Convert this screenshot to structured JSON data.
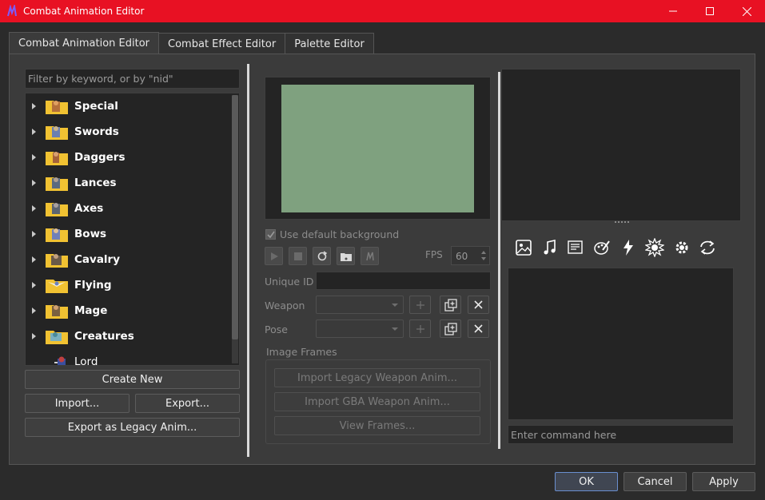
{
  "window": {
    "title": "Combat Animation Editor",
    "title_bar_color": "#e81123"
  },
  "tabs": [
    {
      "label": "Combat Animation Editor",
      "active": true
    },
    {
      "label": "Combat Effect Editor",
      "active": false
    },
    {
      "label": "Palette Editor",
      "active": false
    }
  ],
  "left": {
    "filter_placeholder": "Filter by keyword, or by \"nid\"",
    "tree": [
      {
        "label": "Special",
        "kind": "folder"
      },
      {
        "label": "Swords",
        "kind": "folder"
      },
      {
        "label": "Daggers",
        "kind": "folder"
      },
      {
        "label": "Lances",
        "kind": "folder"
      },
      {
        "label": "Axes",
        "kind": "folder"
      },
      {
        "label": "Bows",
        "kind": "folder"
      },
      {
        "label": "Cavalry",
        "kind": "folder"
      },
      {
        "label": "Flying",
        "kind": "folder"
      },
      {
        "label": "Mage",
        "kind": "folder"
      },
      {
        "label": "Creatures",
        "kind": "folder"
      },
      {
        "label": "Lord",
        "kind": "item"
      }
    ],
    "create_new": "Create New",
    "import": "Import...",
    "export": "Export...",
    "export_legacy": "Export as Legacy Anim..."
  },
  "middle": {
    "preview_color": "#7fa17f",
    "use_default_background": "Use default background",
    "fps_label": "FPS",
    "fps_value": "60",
    "unique_id_label": "Unique ID",
    "weapon_label": "Weapon",
    "pose_label": "Pose",
    "image_frames_label": "Image Frames",
    "import_legacy": "Import Legacy Weapon Anim...",
    "import_gba": "Import GBA Weapon Anim...",
    "view_frames": "View Frames..."
  },
  "right": {
    "command_placeholder": "Enter command here",
    "toolbar_icons": [
      "image-icon",
      "music-icon",
      "text-icon",
      "palette-icon",
      "lightning-icon",
      "burst-icon",
      "gear-icon",
      "loop-icon"
    ]
  },
  "footer": {
    "ok": "OK",
    "cancel": "Cancel",
    "apply": "Apply"
  }
}
